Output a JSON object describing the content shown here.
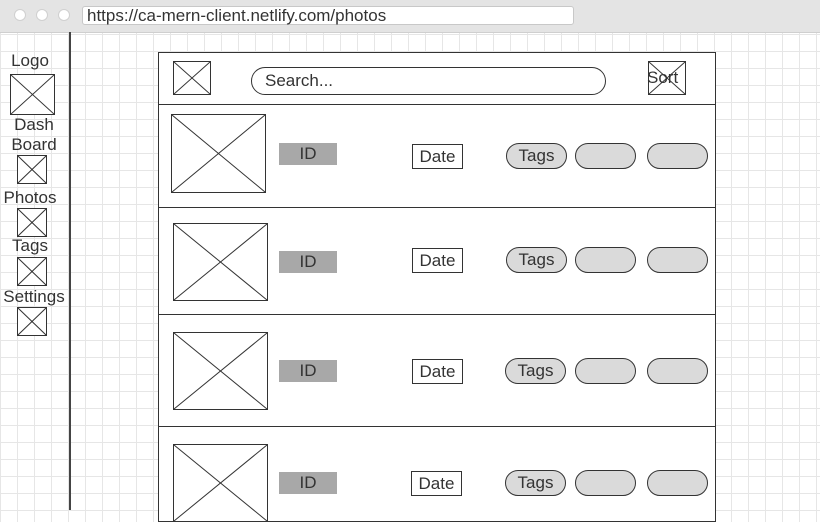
{
  "browser": {
    "url": "https://ca-mern-client.netlify.com/photos"
  },
  "sidebar": {
    "logo_label": "Logo",
    "items": [
      {
        "label": "Dash\nBoard"
      },
      {
        "label": "Photos"
      },
      {
        "label": "Tags"
      },
      {
        "label": "Settings"
      }
    ]
  },
  "toolbar": {
    "search_placeholder": "Search...",
    "sort_label": "Sort"
  },
  "rows": [
    {
      "id_label": "ID",
      "date_label": "Date",
      "tags_label": "Tags"
    },
    {
      "id_label": "ID",
      "date_label": "Date",
      "tags_label": "Tags"
    },
    {
      "id_label": "ID",
      "date_label": "Date",
      "tags_label": "Tags"
    },
    {
      "id_label": "ID",
      "date_label": "Date",
      "tags_label": "Tags"
    }
  ]
}
